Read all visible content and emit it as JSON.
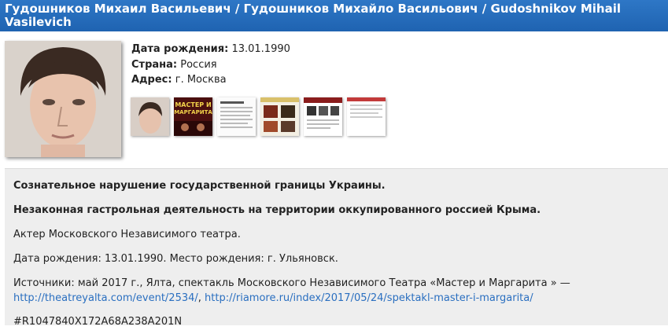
{
  "header": {
    "title": "Гудошников Михаил Васильевич / Гудошников Михайло Васильович / Gudoshnikov Mihail Vasilevich"
  },
  "profile": {
    "birth_label": "Дата рождения:",
    "birth_value": "13.01.1990",
    "country_label": "Страна:",
    "country_value": "Россия",
    "address_label": "Адрес:",
    "address_value": "г. Москва"
  },
  "thumbnails": [
    {
      "name": "portrait-thumbnail"
    },
    {
      "name": "poster-thumbnail",
      "text": "Мастер и Маргарита"
    },
    {
      "name": "article-thumbnail-1"
    },
    {
      "name": "webpage-thumbnail-2"
    },
    {
      "name": "webpage-thumbnail-3"
    },
    {
      "name": "webpage-thumbnail-4"
    }
  ],
  "details": {
    "line1": "Сознательное нарушение государственной границы Украины.",
    "line2": "Незаконная гастрольная деятельность на территории оккупированного россией Крыма.",
    "line3": "Актер Московского Независимого театра.",
    "line4": "Дата рождения: 13.01.1990. Место рождения: г. Ульяновск.",
    "sources_prefix": "Источники: май 2017 г., Ялта, спектакль Московского Независимого Театра «Мастер и Маргарита » —",
    "link1": "http://theatreyalta.com/event/2534/",
    "sep": ", ",
    "link2": "http://riamore.ru/index/2017/05/24/spektakl-master-i-margarita/",
    "code": "#R1047840X172A68A238A201N"
  }
}
